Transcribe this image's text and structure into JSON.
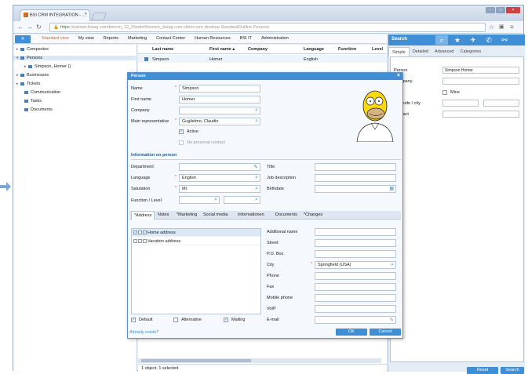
{
  "browser": {
    "tab_title": "BSI CRM INTEGRATION - ...",
    "tab_close": "×",
    "url_scheme": "https",
    "url_rest": "://partner.bsiag.com/bsicrm_12_3/web#/home/c_bsiag.com.client.core.desktop.StandardOutline-Persons",
    "win_min": "–",
    "win_max": "□",
    "win_close": "×"
  },
  "app_menu": {
    "x_label": "✕",
    "items": [
      "Standard view",
      "My view",
      "Reports",
      "Marketing",
      "Contact Center",
      "Human Resources",
      "BSI IT",
      "Administration"
    ],
    "active_index": 0
  },
  "tree": {
    "items": [
      {
        "label": "Companies",
        "expander": "▸"
      },
      {
        "label": "Persons",
        "expander": "▾"
      },
      {
        "label": "Simpson, Homer ()",
        "expander": "▸"
      },
      {
        "label": "Businesses",
        "expander": "▸"
      },
      {
        "label": "Tickets",
        "expander": "▸"
      },
      {
        "label": "Communication",
        "expander": ""
      },
      {
        "label": "Tasks",
        "expander": ""
      },
      {
        "label": "Documents",
        "expander": ""
      }
    ]
  },
  "grid": {
    "headers": [
      "Last name",
      "First name ▴",
      "Company",
      "Language",
      "Function",
      "Level"
    ],
    "row": [
      "Simpson",
      "Homer",
      "",
      "English",
      "",
      ""
    ],
    "status": "1 object, 1 selected"
  },
  "search_panel": {
    "title": "Search",
    "tabs": [
      "Simple",
      "Detailed",
      "Advanced",
      "Categories"
    ],
    "active_tab": 0,
    "fields": {
      "person_label": "Person",
      "person_value": "Simpson Homer",
      "company_label": "Company",
      "mine_label": "Mine",
      "zip_city_label": "Zip code / city",
      "contact_label": "Contact"
    },
    "reset_label": "Reset",
    "search_label": "Search"
  },
  "dialog": {
    "title": "Person",
    "close": "×",
    "name_label": "Name",
    "name_value": "Simpson",
    "firstname_label": "First name",
    "firstname_value": "Homer",
    "company_label": "Company",
    "company_value": "",
    "mainrep_label": "Main representative",
    "mainrep_value": "Guglielmo, Claudio",
    "active_label": "Active",
    "nopersonal_label": "No personal contact",
    "info_section": "Information on person",
    "department_label": "Department",
    "title_label": "Title",
    "language_label": "Language",
    "language_value": "English",
    "jobdesc_label": "Job description",
    "salutation_label": "Salutation",
    "salutation_value": "Mr.",
    "birthdate_label": "Birthdate",
    "function_label": "Function / Level",
    "tabs": [
      "*Address",
      "Notes",
      "*Marketing",
      "Social media",
      "Informationen",
      "Documents",
      "*Changes"
    ],
    "address_rows": [
      {
        "label": "Home address",
        "checks": [
          "✓",
          "",
          "✓"
        ]
      },
      {
        "label": "Vacation address",
        "checks": [
          "",
          "",
          ""
        ]
      }
    ],
    "addname_label": "Additional name",
    "street_label": "Street",
    "pobox_label": "P.O. Box",
    "city_label": "City",
    "city_value": "Springfield (USA)",
    "phone_label": "Phone",
    "fax_label": "Fax",
    "mobile_label": "Mobile phone",
    "voip_label": "VoIP",
    "email_label": "E-mail",
    "default_label": "Default",
    "alternative_label": "Alternative",
    "mailing_label": "Mailing",
    "already_exists": "Already exists?",
    "ok_label": "OK",
    "cancel_label": "Cancel"
  },
  "colors": {
    "accent": "#3f8fd6",
    "active_menu": "#d96b1f",
    "selection": "#dbe8f6"
  }
}
